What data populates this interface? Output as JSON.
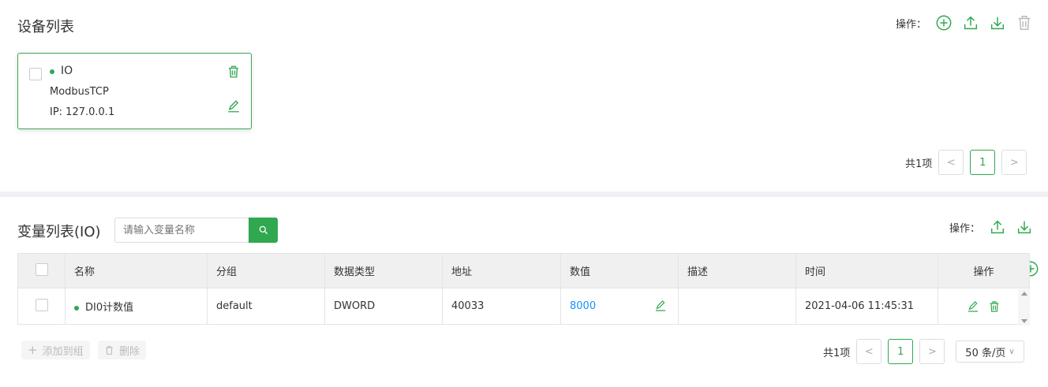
{
  "colors": {
    "accent": "#2fa84f",
    "link": "#1890ff"
  },
  "device_section": {
    "title": "设备列表",
    "ops_label": "操作：",
    "ops_icons": [
      "add-circle-icon",
      "upload-icon",
      "download-icon",
      "trash-icon"
    ],
    "device": {
      "name": "IO",
      "protocol": "ModbusTCP",
      "ip": "IP: 127.0.0.1"
    },
    "pager": {
      "total": "共1项",
      "page": "1",
      "prev": "<",
      "next": ">"
    }
  },
  "variable_section": {
    "title": "变量列表(IO)",
    "search_placeholder": "请输入变量名称",
    "ops_label": "操作：",
    "table": {
      "headers": [
        "名称",
        "分组",
        "数据类型",
        "地址",
        "数值",
        "描述",
        "时间",
        "操作"
      ],
      "rows": [
        {
          "name": "DI0计数值",
          "group": "default",
          "type": "DWORD",
          "address": "40033",
          "value": "8000",
          "desc": "",
          "time": "2021-04-06 11:45:31"
        }
      ]
    },
    "add_to_group": "添加到组",
    "delete": "删除",
    "pager": {
      "total": "共1项",
      "page": "1",
      "prev": "<",
      "next": ">",
      "page_size": "50 条/页"
    }
  }
}
